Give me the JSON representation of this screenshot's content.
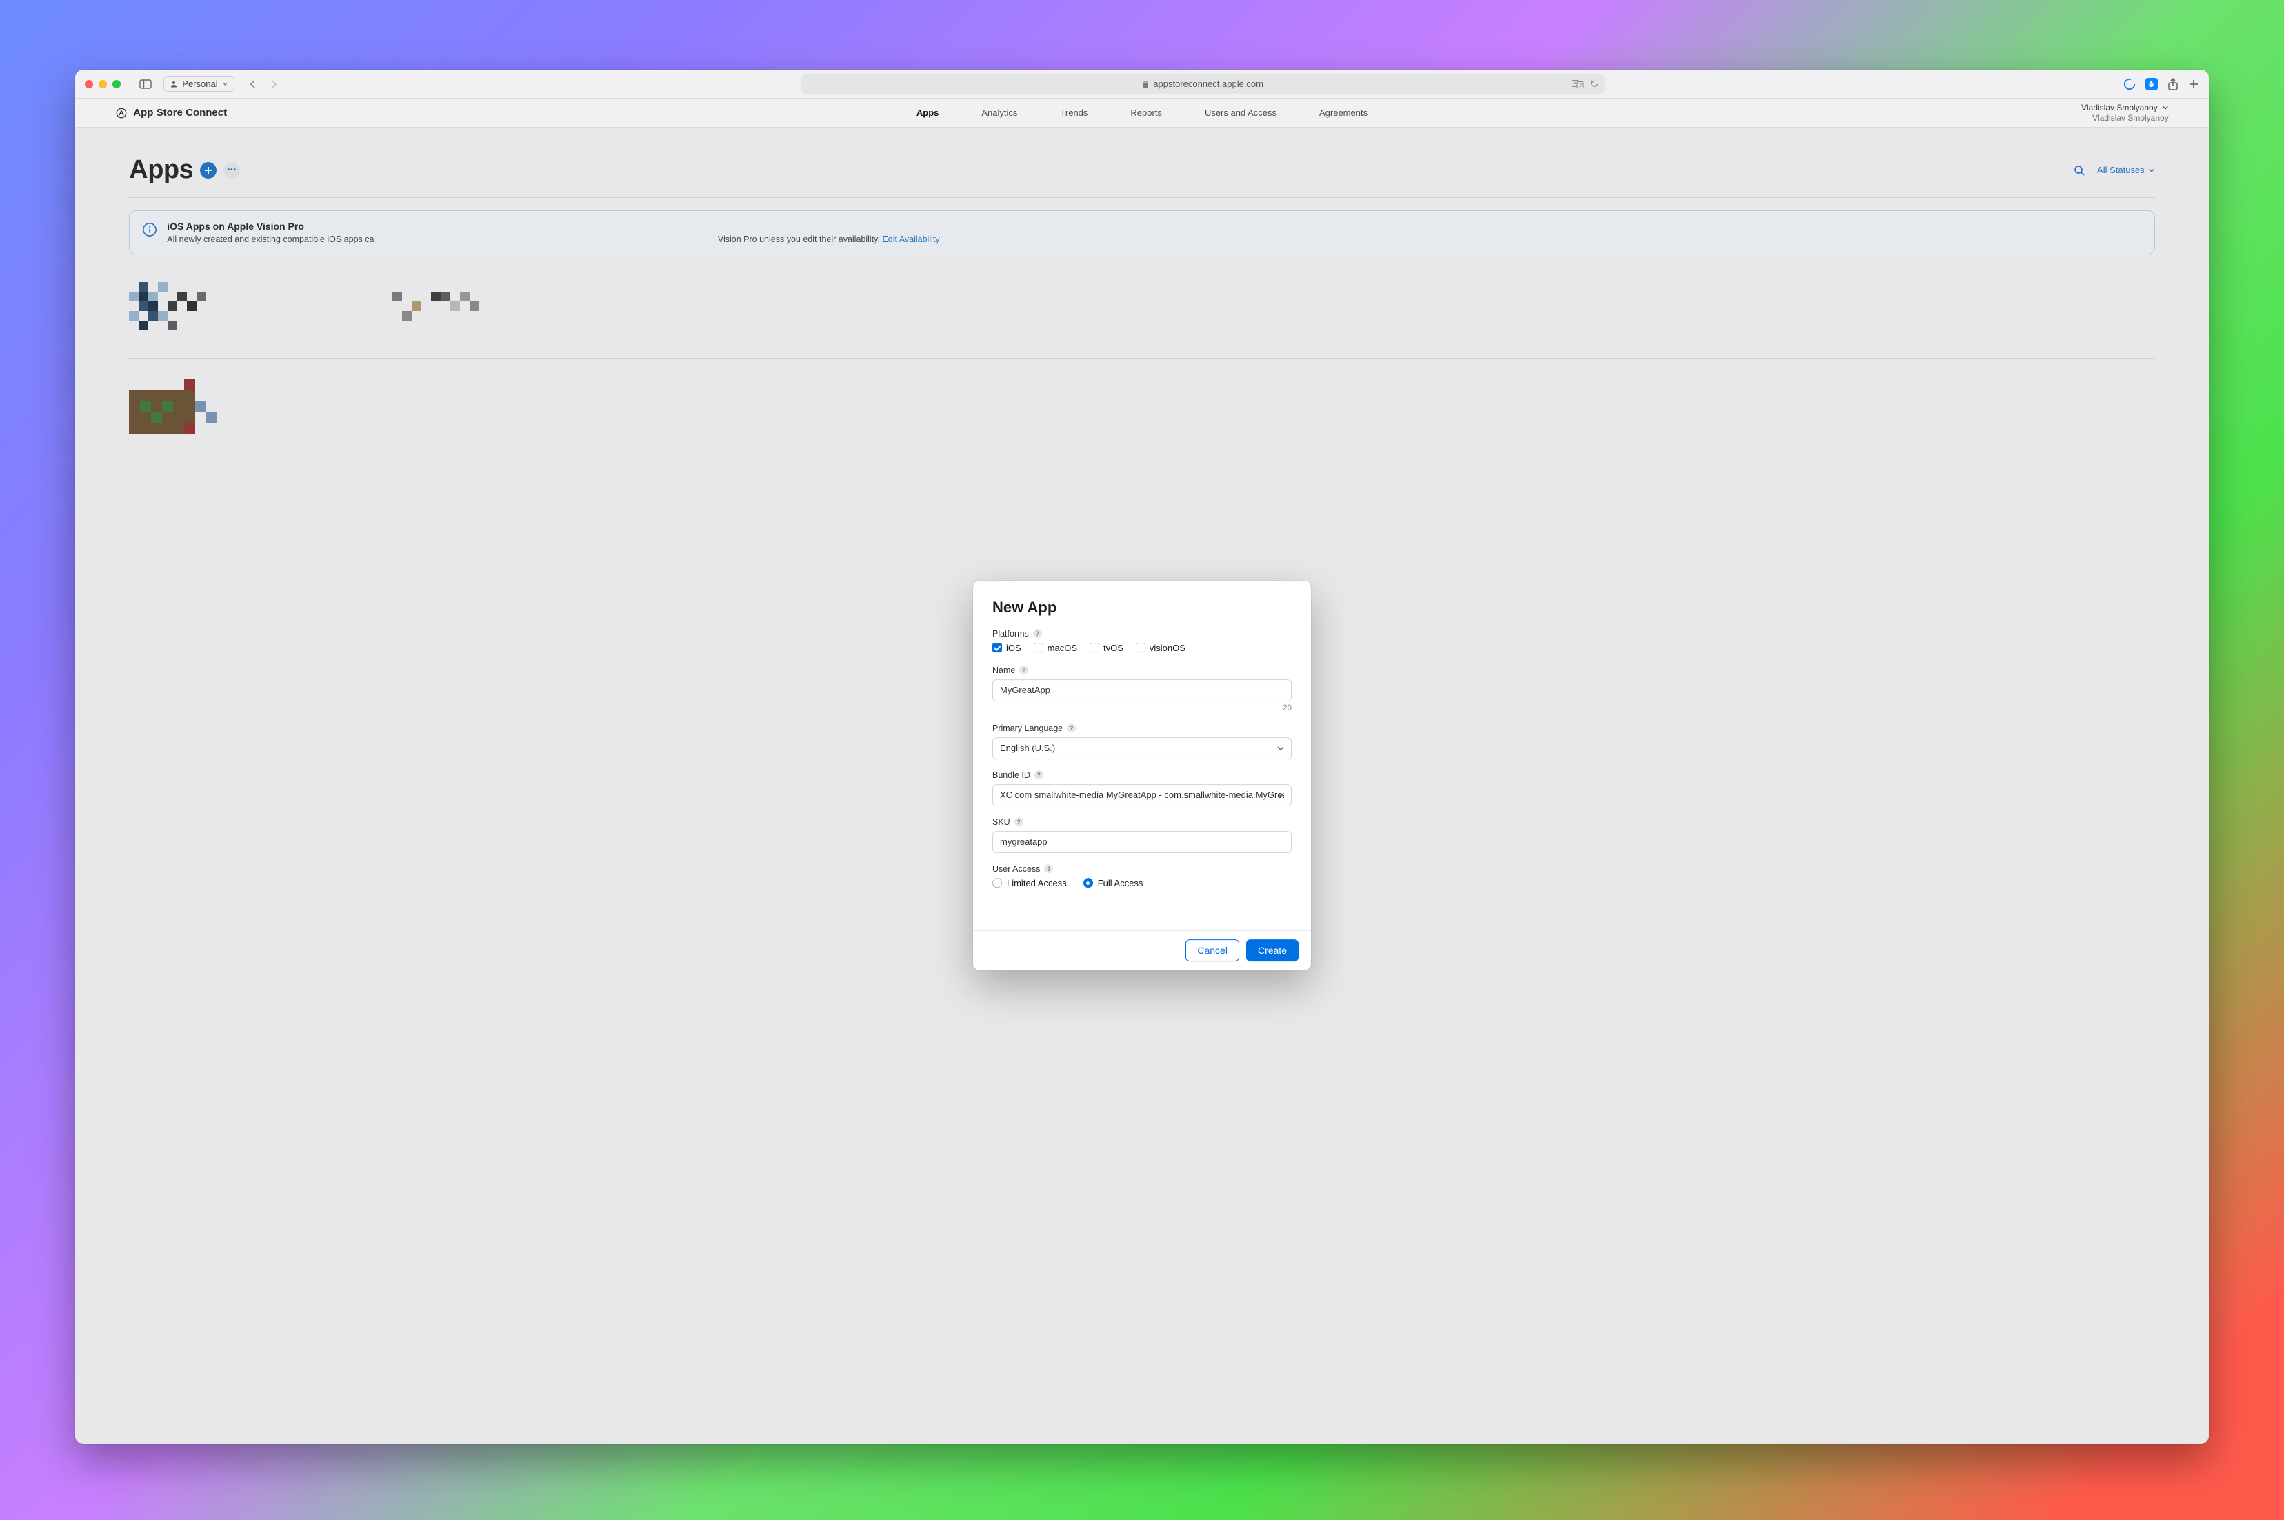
{
  "browser": {
    "profile_label": "Personal",
    "address": "appstoreconnect.apple.com"
  },
  "header": {
    "brand": "App Store Connect",
    "nav": {
      "apps": "Apps",
      "analytics": "Analytics",
      "trends": "Trends",
      "reports": "Reports",
      "users": "Users and Access",
      "agreements": "Agreements"
    },
    "user_line1": "Vladislav Smolyanoy",
    "user_line2": "Vladislav Smolyanoy"
  },
  "page": {
    "title": "Apps",
    "filter_label": "All Statuses",
    "banner_title": "iOS Apps on Apple Vision Pro",
    "banner_body_left": "All newly created and existing compatible iOS apps ca",
    "banner_body_right": " Vision Pro unless you edit their availability. ",
    "banner_link": "Edit Availability"
  },
  "modal": {
    "title": "New App",
    "platforms_label": "Platforms",
    "platforms": {
      "ios": "iOS",
      "macos": "macOS",
      "tvos": "tvOS",
      "visionos": "visionOS"
    },
    "name_label": "Name",
    "name_value": "MyGreatApp",
    "name_counter": "20",
    "lang_label": "Primary Language",
    "lang_value": "English (U.S.)",
    "bundle_label": "Bundle ID",
    "bundle_value": "XC com smallwhite-media MyGreatApp - com.smallwhite-media.MyGreatApp",
    "sku_label": "SKU",
    "sku_value": "mygreatapp",
    "ua_label": "User Access",
    "ua_limited": "Limited Access",
    "ua_full": "Full Access",
    "cancel": "Cancel",
    "create": "Create"
  }
}
